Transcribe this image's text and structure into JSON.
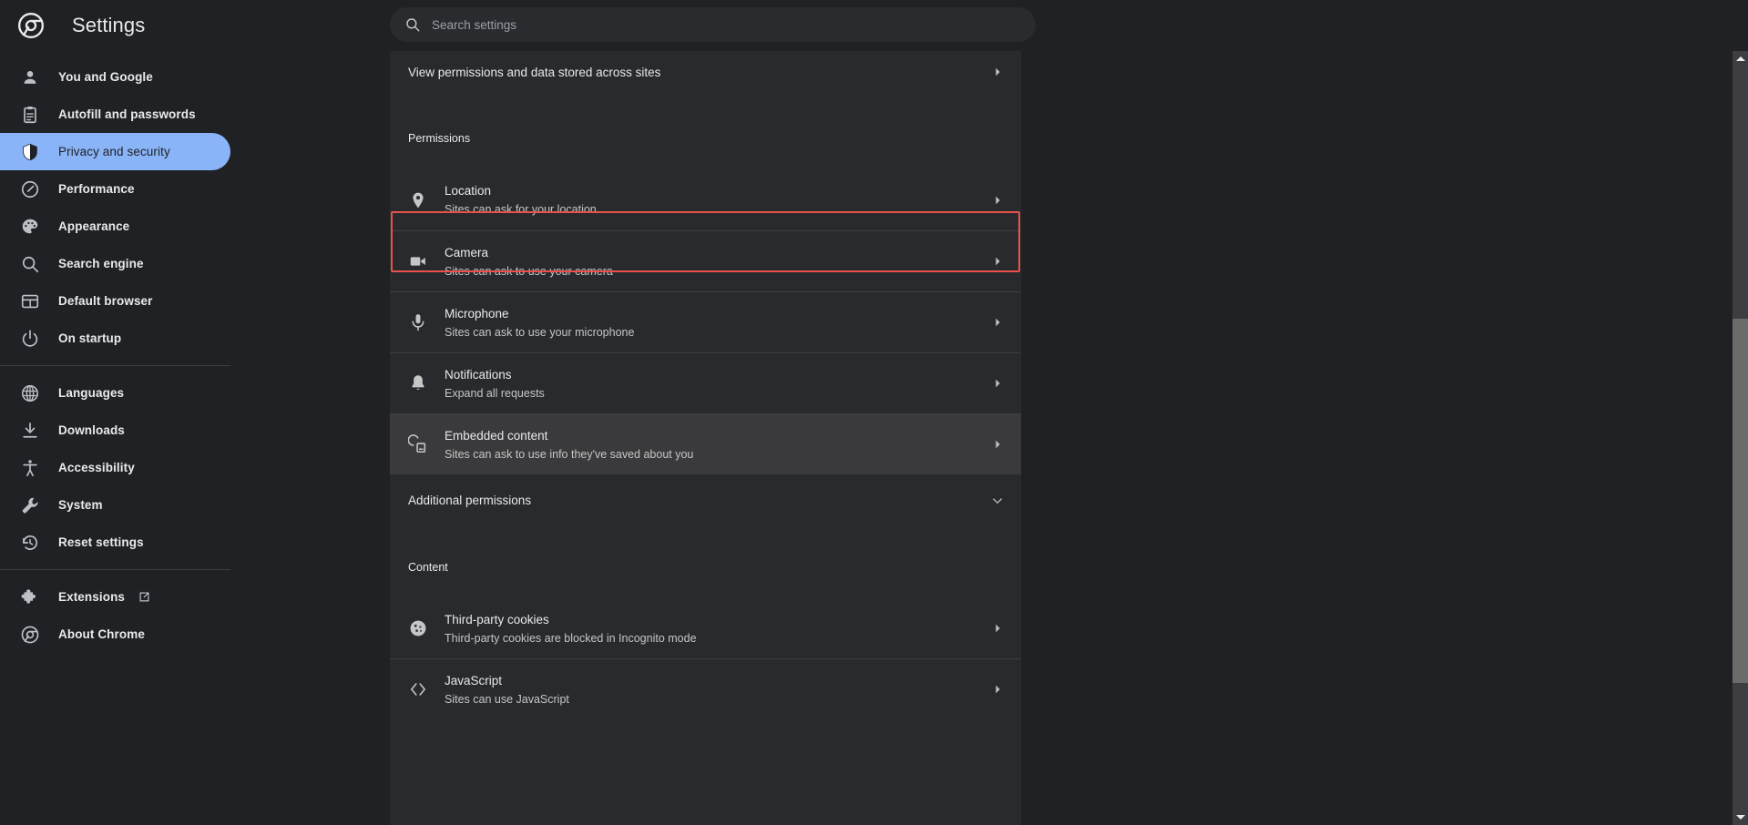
{
  "header": {
    "title": "Settings",
    "logo_icon": "chrome-logo-icon"
  },
  "search": {
    "placeholder": "Search settings",
    "value": "",
    "icon": "search-icon"
  },
  "sidebar": {
    "groups": [
      {
        "items": [
          {
            "label": "You and Google",
            "icon": "person-icon",
            "selected": false
          },
          {
            "label": "Autofill and passwords",
            "icon": "clipboard-icon",
            "selected": false
          },
          {
            "label": "Privacy and security",
            "icon": "shield-icon",
            "selected": true
          },
          {
            "label": "Performance",
            "icon": "speedometer-icon",
            "selected": false
          },
          {
            "label": "Appearance",
            "icon": "palette-icon",
            "selected": false
          },
          {
            "label": "Search engine",
            "icon": "search-icon",
            "selected": false
          },
          {
            "label": "Default browser",
            "icon": "browser-window-icon",
            "selected": false
          },
          {
            "label": "On startup",
            "icon": "power-icon",
            "selected": false
          }
        ]
      },
      {
        "items": [
          {
            "label": "Languages",
            "icon": "globe-icon",
            "selected": false
          },
          {
            "label": "Downloads",
            "icon": "download-icon",
            "selected": false
          },
          {
            "label": "Accessibility",
            "icon": "accessibility-icon",
            "selected": false
          },
          {
            "label": "System",
            "icon": "wrench-icon",
            "selected": false
          },
          {
            "label": "Reset settings",
            "icon": "history-icon",
            "selected": false
          }
        ]
      },
      {
        "items": [
          {
            "label": "Extensions",
            "icon": "puzzle-icon",
            "selected": false,
            "external": true
          },
          {
            "label": "About Chrome",
            "icon": "chrome-logo-icon",
            "selected": false
          }
        ]
      }
    ]
  },
  "main": {
    "top_row": {
      "title": "View permissions and data stored across sites",
      "arrow_icon": "chevron-right-icon"
    },
    "permissions_heading": "Permissions",
    "permissions": [
      {
        "title": "Location",
        "subtitle": "Sites can ask for your location",
        "icon": "location-pin-icon",
        "highlighted": false,
        "hovered": false
      },
      {
        "title": "Camera",
        "subtitle": "Sites can ask to use your camera",
        "icon": "video-camera-icon",
        "highlighted": true,
        "hovered": false
      },
      {
        "title": "Microphone",
        "subtitle": "Sites can ask to use your microphone",
        "icon": "microphone-icon",
        "highlighted": false,
        "hovered": false
      },
      {
        "title": "Notifications",
        "subtitle": "Expand all requests",
        "icon": "bell-icon",
        "highlighted": false,
        "hovered": false
      },
      {
        "title": "Embedded content",
        "subtitle": "Sites can ask to use info they've saved about you",
        "icon": "embedded-content-icon",
        "highlighted": false,
        "hovered": true
      }
    ],
    "additional_permissions": {
      "label": "Additional permissions",
      "arrow_icon": "chevron-down-icon"
    },
    "content_heading": "Content",
    "content_rows": [
      {
        "title": "Third-party cookies",
        "subtitle": "Third-party cookies are blocked in Incognito mode",
        "icon": "cookie-icon"
      },
      {
        "title": "JavaScript",
        "subtitle": "Sites can use JavaScript",
        "icon": "code-brackets-icon"
      }
    ]
  },
  "scrollbar": {
    "up_arrow_icon": "scroll-up-arrow-icon",
    "down_arrow_icon": "scroll-down-arrow-icon"
  },
  "colors": {
    "page_bg": "#202124",
    "card_bg": "#292a2d",
    "accent_selected": "#8ab4f8",
    "highlight_box": "#e8524b",
    "hover_row": "#3a3a3c",
    "divider": "#3c4043"
  }
}
